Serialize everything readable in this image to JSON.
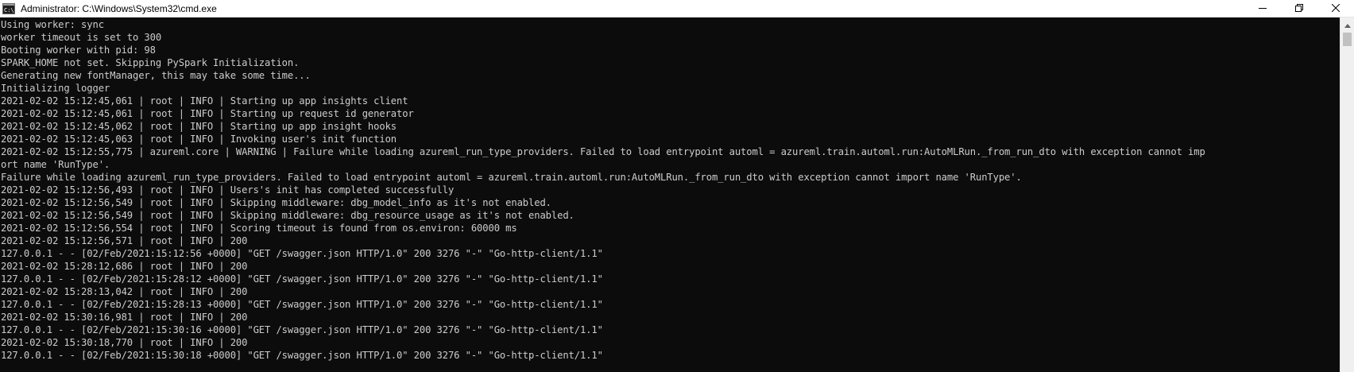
{
  "window": {
    "title": "Administrator: C:\\Windows\\System32\\cmd.exe",
    "app_icon": "cmd-icon"
  },
  "controls": {
    "minimize_icon": "minimize-icon",
    "maximize_icon": "restore-icon",
    "close_icon": "close-icon"
  },
  "colors": {
    "console_background": "#0c0c0c",
    "console_text": "#cccccc",
    "titlebar_background": "#ffffff"
  },
  "console": {
    "lines": [
      "Using worker: sync",
      "worker timeout is set to 300",
      "Booting worker with pid: 98",
      "SPARK_HOME not set. Skipping PySpark Initialization.",
      "Generating new fontManager, this may take some time...",
      "Initializing logger",
      "2021-02-02 15:12:45,061 | root | INFO | Starting up app insights client",
      "2021-02-02 15:12:45,061 | root | INFO | Starting up request id generator",
      "2021-02-02 15:12:45,062 | root | INFO | Starting up app insight hooks",
      "2021-02-02 15:12:45,063 | root | INFO | Invoking user's init function",
      "2021-02-02 15:12:55,775 | azureml.core | WARNING | Failure while loading azureml_run_type_providers. Failed to load entrypoint automl = azureml.train.automl.run:AutoMLRun._from_run_dto with exception cannot imp",
      "ort name 'RunType'.",
      "Failure while loading azureml_run_type_providers. Failed to load entrypoint automl = azureml.train.automl.run:AutoMLRun._from_run_dto with exception cannot import name 'RunType'.",
      "2021-02-02 15:12:56,493 | root | INFO | Users's init has completed successfully",
      "2021-02-02 15:12:56,549 | root | INFO | Skipping middleware: dbg_model_info as it's not enabled.",
      "2021-02-02 15:12:56,549 | root | INFO | Skipping middleware: dbg_resource_usage as it's not enabled.",
      "2021-02-02 15:12:56,554 | root | INFO | Scoring timeout is found from os.environ: 60000 ms",
      "2021-02-02 15:12:56,571 | root | INFO | 200",
      "127.0.0.1 - - [02/Feb/2021:15:12:56 +0000] \"GET /swagger.json HTTP/1.0\" 200 3276 \"-\" \"Go-http-client/1.1\"",
      "2021-02-02 15:28:12,686 | root | INFO | 200",
      "127.0.0.1 - - [02/Feb/2021:15:28:12 +0000] \"GET /swagger.json HTTP/1.0\" 200 3276 \"-\" \"Go-http-client/1.1\"",
      "2021-02-02 15:28:13,042 | root | INFO | 200",
      "127.0.0.1 - - [02/Feb/2021:15:28:13 +0000] \"GET /swagger.json HTTP/1.0\" 200 3276 \"-\" \"Go-http-client/1.1\"",
      "2021-02-02 15:30:16,981 | root | INFO | 200",
      "127.0.0.1 - - [02/Feb/2021:15:30:16 +0000] \"GET /swagger.json HTTP/1.0\" 200 3276 \"-\" \"Go-http-client/1.1\"",
      "2021-02-02 15:30:18,770 | root | INFO | 200",
      "127.0.0.1 - - [02/Feb/2021:15:30:18 +0000] \"GET /swagger.json HTTP/1.0\" 200 3276 \"-\" \"Go-http-client/1.1\""
    ]
  },
  "scrollbar": {
    "up_icon": "scroll-up-arrow-icon"
  }
}
